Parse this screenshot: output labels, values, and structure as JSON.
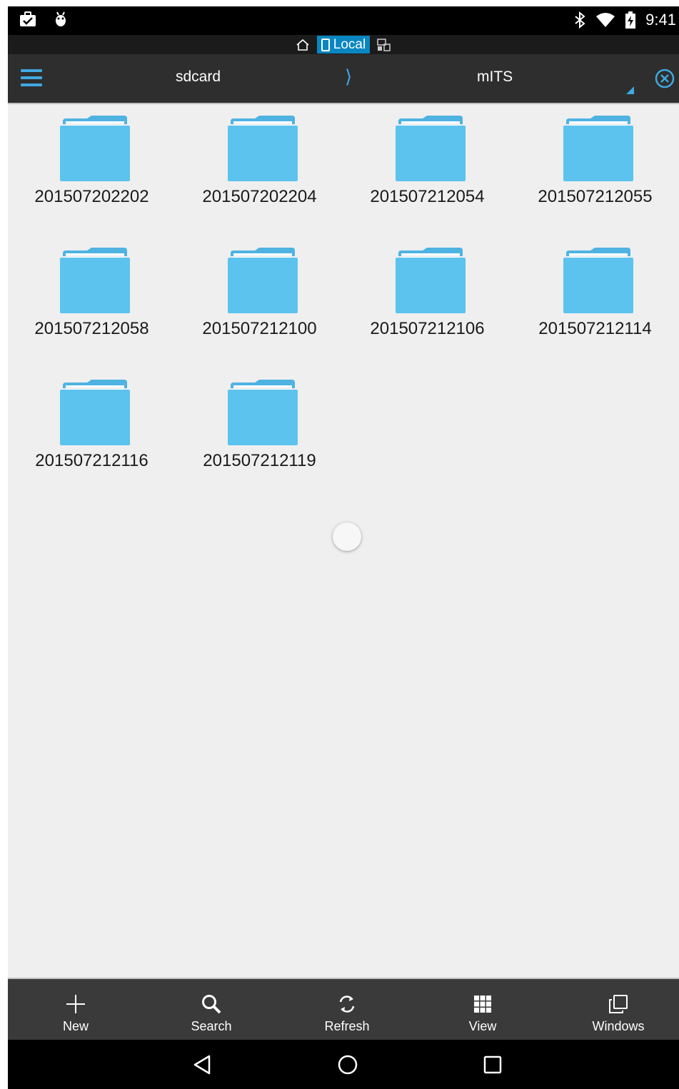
{
  "status_bar": {
    "time": "9:41",
    "left_icons": [
      "briefcase-check-icon",
      "android-debug-icon"
    ],
    "right_icons": [
      "bluetooth-icon",
      "wifi-icon",
      "battery-charging-icon"
    ]
  },
  "location": {
    "home_icon": "home-icon",
    "active_label": "Local",
    "remote_icon": "network-devices-icon"
  },
  "path_bar": {
    "crumbs": [
      "sdcard",
      "mITS"
    ],
    "separator": "⟩"
  },
  "folders": [
    {
      "name": "201507202202"
    },
    {
      "name": "201507202204"
    },
    {
      "name": "201507212054"
    },
    {
      "name": "201507212055"
    },
    {
      "name": "201507212058"
    },
    {
      "name": "201507212100"
    },
    {
      "name": "201507212106"
    },
    {
      "name": "201507212114"
    },
    {
      "name": "201507212116"
    },
    {
      "name": "201507212119"
    }
  ],
  "toolbar": {
    "items": [
      {
        "label": "New",
        "icon": "plus-icon"
      },
      {
        "label": "Search",
        "icon": "search-icon"
      },
      {
        "label": "Refresh",
        "icon": "refresh-icon"
      },
      {
        "label": "View",
        "icon": "grid-view-icon"
      },
      {
        "label": "Windows",
        "icon": "windows-icon"
      }
    ]
  },
  "nav_bar": {
    "icons": [
      "back-icon",
      "home-circle-icon",
      "recents-icon"
    ]
  },
  "colors": {
    "accent": "#3fa9e0",
    "folder": "#5bc3ee",
    "local_badge": "#0a86c0"
  }
}
